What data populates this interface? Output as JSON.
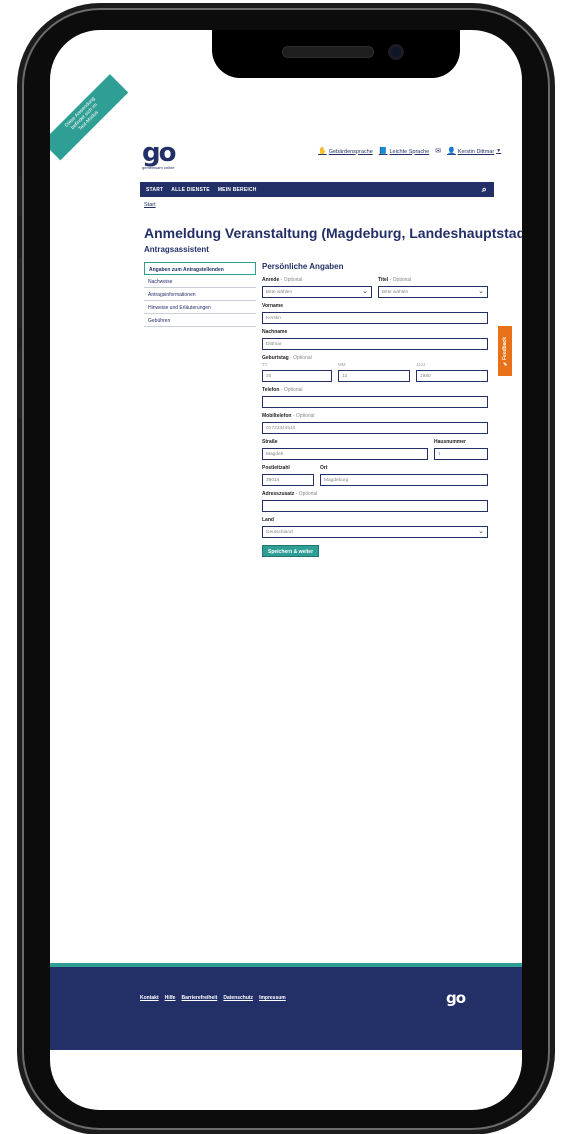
{
  "beta": {
    "line1": "Diese Anwendung",
    "line2": "befindet sich im",
    "line3": "Test-Modus"
  },
  "brand": {
    "logo": "go",
    "tagline": "gemeinsam online"
  },
  "utility": {
    "sign_language": "Gebärdensprache",
    "easy_language": "Leichte Sprache",
    "user": "Kerstin Dittmar"
  },
  "nav": {
    "items": [
      "START",
      "ALLE DIENSTE",
      "MEIN BEREICH"
    ]
  },
  "breadcrumb": "Start",
  "page_title": "Anmeldung Veranstaltung (Magdeburg, Landeshauptstadt)",
  "subtitle": "Antragsassistent",
  "steps": [
    "Angaben zum Antragstellenden",
    "Nachweise",
    "Antragsinformationen",
    "Hinweise und Erläuterungen",
    "Gebühren"
  ],
  "form": {
    "heading": "Persönliche Angaben",
    "optional": "- Optional",
    "anrede": {
      "label": "Anrede",
      "value": "Bitte wählen"
    },
    "titel": {
      "label": "Titel",
      "value": "Bitte wählen"
    },
    "vorname": {
      "label": "Vorname",
      "value": "Kerstin"
    },
    "nachname": {
      "label": "Nachname",
      "value": "Dittmar"
    },
    "geburtstag": {
      "label": "Geburtstag",
      "tt": "TT",
      "mm": "MM",
      "jjjj": "JJJJ",
      "day": "20",
      "month": "12",
      "year": "1980"
    },
    "telefon": {
      "label": "Telefon",
      "value": ""
    },
    "mobil": {
      "label": "Mobiltelefon",
      "value": "01723344510"
    },
    "strasse": {
      "label": "Straße",
      "value": "Magdeb"
    },
    "hausnummer": {
      "label": "Hausnummer",
      "value": "1"
    },
    "plz": {
      "label": "Postleitzahl",
      "value": "39014"
    },
    "ort": {
      "label": "Ort",
      "value": "Magdeburg"
    },
    "adresszusatz": {
      "label": "Adresszusatz",
      "value": ""
    },
    "land": {
      "label": "Land",
      "value": "Deutschland"
    },
    "submit": "Speichern & weiter"
  },
  "feedback": "Feedback",
  "footer": {
    "links": [
      "Kontakt",
      "Hilfe",
      "Barrierefreiheit",
      "Datenschutz",
      "Impressum"
    ],
    "logo": "go"
  },
  "colors": {
    "primary": "#233067",
    "accent": "#2f9e95",
    "feedback": "#e8711a"
  }
}
